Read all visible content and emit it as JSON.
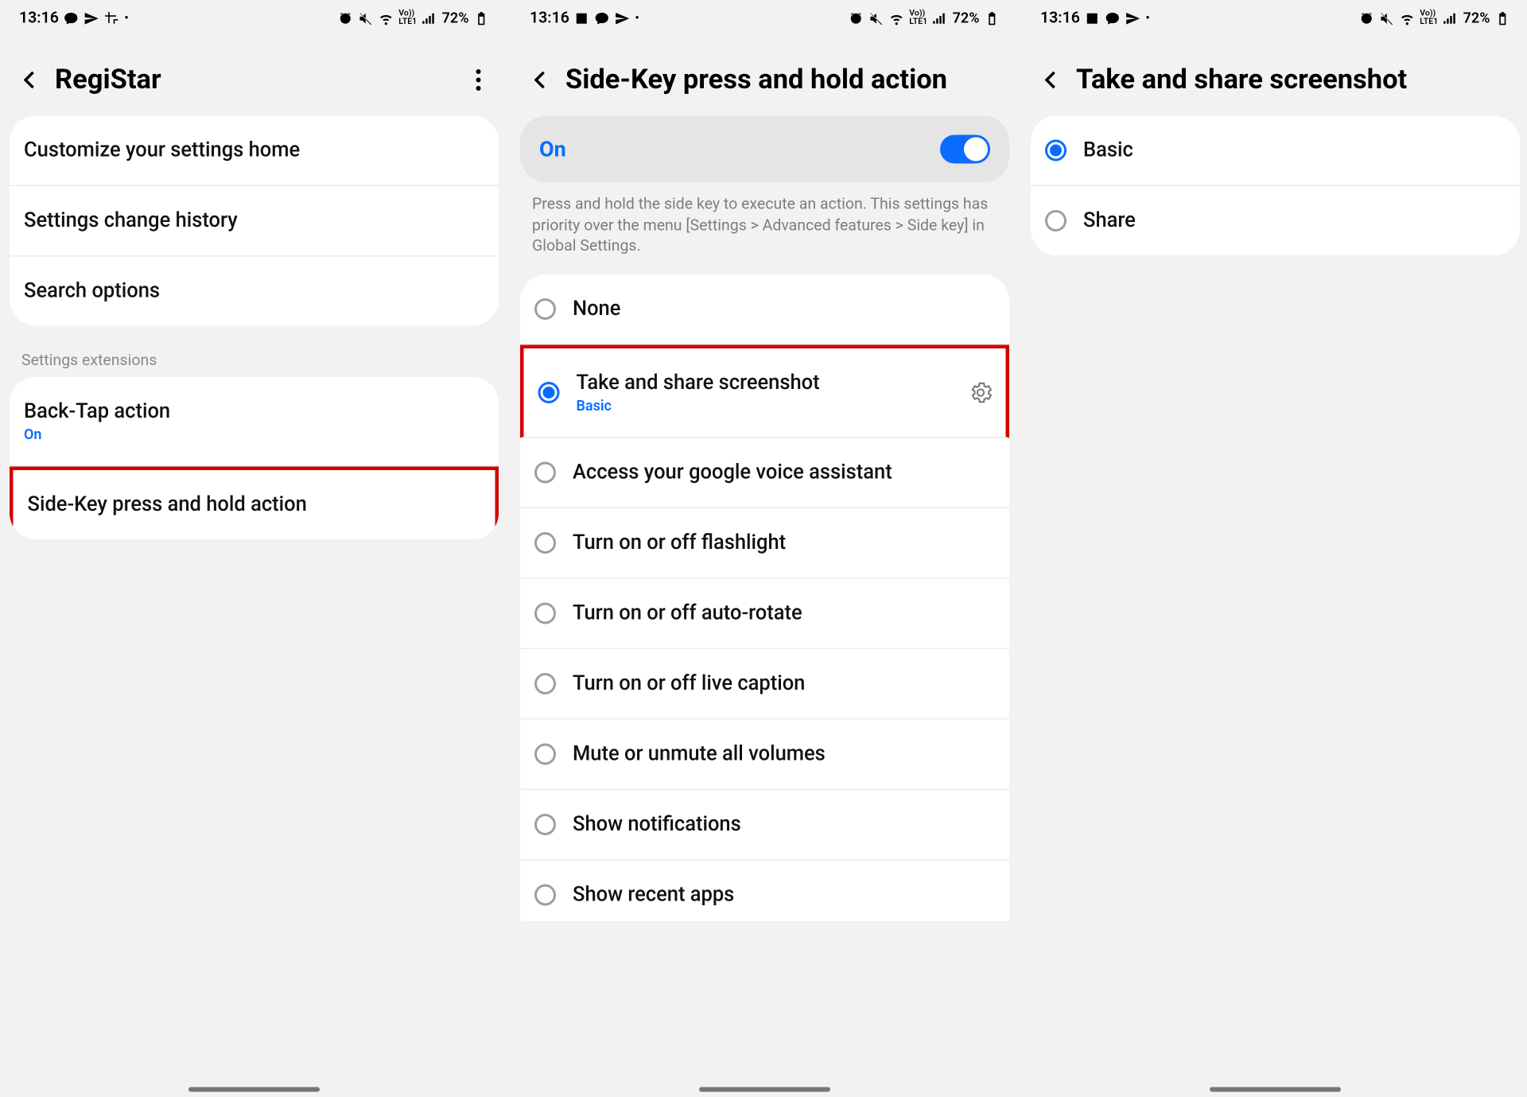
{
  "statusbar": {
    "time": "13:16",
    "battery": "72%"
  },
  "screen1": {
    "title": "RegiStar",
    "items": [
      "Customize your settings home",
      "Settings change history",
      "Search options"
    ],
    "extensions_heading": "Settings extensions",
    "ext_items": [
      {
        "label": "Back-Tap action",
        "sub": "On"
      },
      {
        "label": "Side-Key press and hold action"
      }
    ]
  },
  "screen2": {
    "title": "Side-Key press and hold action",
    "toggle_label": "On",
    "description": "Press and hold the side key to execute an action. This settings has priority over the menu [Settings > Advanced features > Side key] in Global Settings.",
    "options": [
      {
        "label": "None",
        "selected": false
      },
      {
        "label": "Take and share screenshot",
        "sub": "Basic",
        "selected": true,
        "gear": true
      },
      {
        "label": "Access your google voice assistant",
        "selected": false
      },
      {
        "label": "Turn on or off flashlight",
        "selected": false
      },
      {
        "label": "Turn on or off auto-rotate",
        "selected": false
      },
      {
        "label": "Turn on or off live caption",
        "selected": false
      },
      {
        "label": "Mute or unmute all volumes",
        "selected": false
      },
      {
        "label": "Show notifications",
        "selected": false
      },
      {
        "label": "Show recent apps",
        "selected": false
      }
    ]
  },
  "screen3": {
    "title": "Take and share screenshot",
    "options": [
      {
        "label": "Basic",
        "selected": true
      },
      {
        "label": "Share",
        "selected": false
      }
    ]
  }
}
